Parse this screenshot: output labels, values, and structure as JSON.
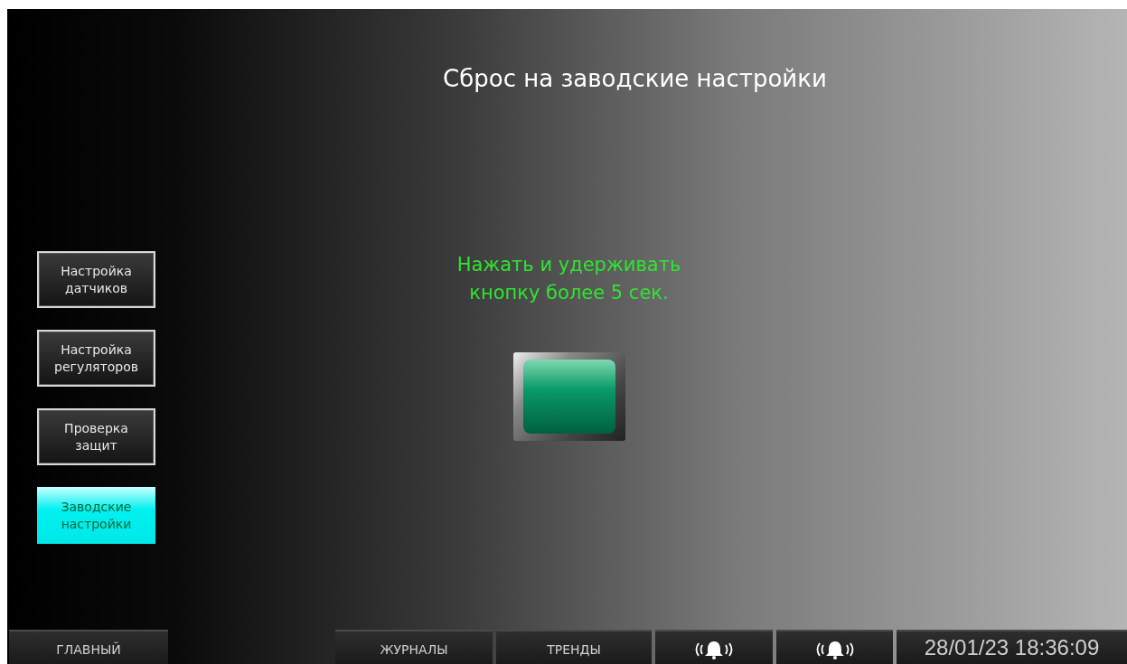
{
  "title": "Сброс на заводские настройки",
  "side_menu": [
    {
      "label": "Настройка датчиков",
      "selected": false
    },
    {
      "label": "Настройка регуляторов",
      "selected": false
    },
    {
      "label": "Проверка защит",
      "selected": false
    },
    {
      "label": "Заводские настройки",
      "selected": true
    }
  ],
  "instruction": [
    "Нажать и удерживать",
    "кнопку более 5 сек."
  ],
  "bottom_bar": [
    {
      "kind": "text",
      "label": "ГЛАВНЫЙ"
    },
    {
      "kind": "gap"
    },
    {
      "kind": "text",
      "label": "ЖУРНАЛЫ"
    },
    {
      "kind": "text",
      "label": "ТРЕНДЫ"
    },
    {
      "kind": "alarm"
    },
    {
      "kind": "alarm"
    },
    {
      "kind": "clock",
      "label": "28/01/23 18:36:09"
    }
  ]
}
